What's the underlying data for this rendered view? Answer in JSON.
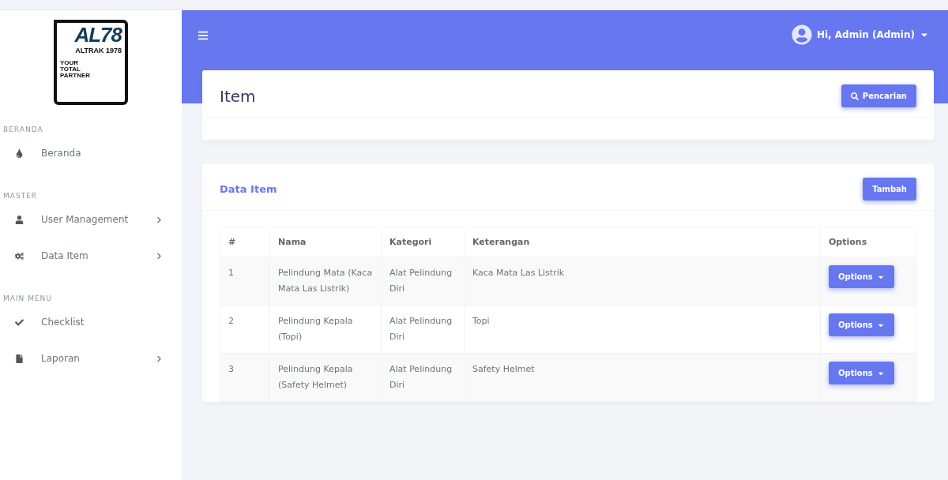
{
  "logo": {
    "mark": "AL78",
    "brand": "ALTRAK 1978",
    "tagline": "YOUR TOTAL PARTNER"
  },
  "sidebar": {
    "sections": [
      {
        "heading": "BERANDA",
        "items": [
          {
            "label": "Beranda",
            "kind": "drop",
            "has_submenu": false
          }
        ]
      },
      {
        "heading": "MASTER",
        "items": [
          {
            "label": "User Management",
            "kind": "user",
            "has_submenu": true
          },
          {
            "label": "Data Item",
            "kind": "gears",
            "has_submenu": true
          }
        ]
      },
      {
        "heading": "MAIN MENU",
        "items": [
          {
            "label": "Checklist",
            "kind": "check",
            "has_submenu": false
          },
          {
            "label": "Laporan",
            "kind": "file",
            "has_submenu": true
          }
        ]
      }
    ]
  },
  "topbar": {
    "user": "Hi, Admin (Admin)"
  },
  "page": {
    "title": "Item",
    "search_button": "Pencarian"
  },
  "data_card": {
    "title": "Data Item",
    "add_button": "Tambah",
    "table": {
      "columns": [
        "#",
        "Nama",
        "Kategori",
        "Keterangan",
        "Options"
      ],
      "rows": [
        {
          "no": "1",
          "nama": "Pelindung Mata (Kaca Mata Las Listrik)",
          "kategori": "Alat Pelindung Diri",
          "keterangan": "Kaca Mata Las Listrik",
          "action": "Options"
        },
        {
          "no": "2",
          "nama": "Pelindung Kepala (Topi)",
          "kategori": "Alat Pelindung Diri",
          "keterangan": "Topi",
          "action": "Options"
        },
        {
          "no": "3",
          "nama": "Pelindung Kepala (Safety Helmet)",
          "kategori": "Alat Pelindung Diri",
          "keterangan": "Safety Helmet",
          "action": "Options"
        }
      ]
    }
  }
}
